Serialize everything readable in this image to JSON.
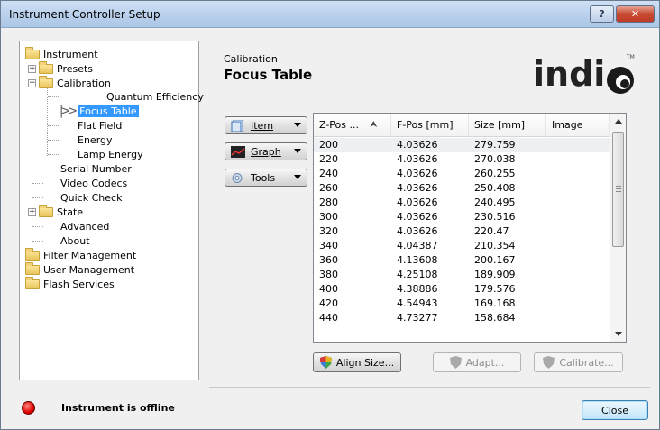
{
  "window": {
    "title": "Instrument Controller Setup",
    "help_label": "?",
    "close_label": "✕"
  },
  "tree": {
    "items": [
      {
        "label": "Instrument",
        "expander": ""
      },
      {
        "label": "Presets",
        "expander": "+"
      },
      {
        "label": "Calibration",
        "expander": "−"
      },
      {
        "label": "Quantum Efficiency"
      },
      {
        "label": "Focus Table",
        "selected": true
      },
      {
        "label": "Flat Field"
      },
      {
        "label": "Energy"
      },
      {
        "label": "Lamp Energy"
      },
      {
        "label": "Serial Number"
      },
      {
        "label": "Video Codecs"
      },
      {
        "label": "Quick Check"
      },
      {
        "label": "State",
        "expander": "+"
      },
      {
        "label": "Advanced"
      },
      {
        "label": "About"
      },
      {
        "label": "Filter Management"
      },
      {
        "label": "User Management"
      },
      {
        "label": "Flash Services"
      }
    ]
  },
  "header": {
    "section": "Calibration",
    "title": "Focus Table",
    "logo_text": "indiGO",
    "logo_mark": "TM"
  },
  "actions": {
    "item": {
      "label": "Item",
      "icon": "document-icon"
    },
    "graph": {
      "label": "Graph",
      "icon": "graph-icon"
    },
    "tools": {
      "label": "Tools",
      "icon": "tools-icon"
    }
  },
  "table": {
    "columns": [
      "Z-Pos ...",
      "F-Pos [mm]",
      "Size [mm]",
      "Image"
    ],
    "sort_indicator": "⮝",
    "rows": [
      [
        "200",
        "4.03626",
        "279.759",
        ""
      ],
      [
        "220",
        "4.03626",
        "270.038",
        ""
      ],
      [
        "240",
        "4.03626",
        "260.255",
        ""
      ],
      [
        "260",
        "4.03626",
        "250.408",
        ""
      ],
      [
        "280",
        "4.03626",
        "240.495",
        ""
      ],
      [
        "300",
        "4.03626",
        "230.516",
        ""
      ],
      [
        "320",
        "4.03626",
        "220.47",
        ""
      ],
      [
        "340",
        "4.04387",
        "210.354",
        ""
      ],
      [
        "360",
        "4.13608",
        "200.167",
        ""
      ],
      [
        "380",
        "4.25108",
        "189.909",
        ""
      ],
      [
        "400",
        "4.38886",
        "179.576",
        ""
      ],
      [
        "420",
        "4.54943",
        "169.168",
        ""
      ],
      [
        "440",
        "4.73277",
        "158.684",
        ""
      ]
    ]
  },
  "buttons": {
    "align_size": "Align Size...",
    "adapt": "Adapt...",
    "calibrate": "Calibrate...",
    "close": "Close"
  },
  "status": {
    "text": "Instrument is offline",
    "color": "#e00000"
  }
}
